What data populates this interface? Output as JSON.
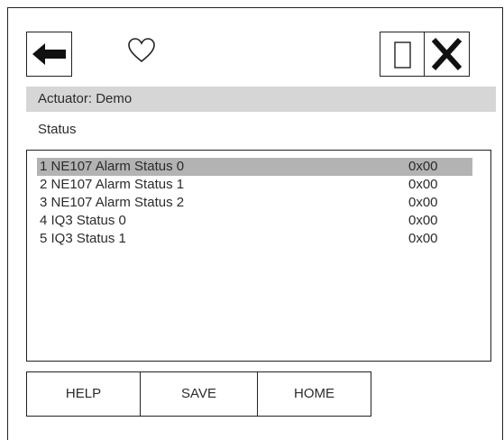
{
  "header": {
    "back_icon": "left-arrow-icon",
    "favorite_icon": "heart-outline-icon",
    "window_icon": "window-rectangle-icon",
    "close_icon": "close-x-icon"
  },
  "actuator_label": "Actuator: Demo",
  "section_title": "Status",
  "rows": [
    {
      "name": "1 NE107 Alarm Status 0",
      "value": "0x00",
      "selected": true
    },
    {
      "name": "2 NE107 Alarm Status 1",
      "value": "0x00",
      "selected": false
    },
    {
      "name": "3 NE107 Alarm Status 2",
      "value": "0x00",
      "selected": false
    },
    {
      "name": "4 IQ3 Status 0",
      "value": "0x00",
      "selected": false
    },
    {
      "name": "5 IQ3 Status 1",
      "value": "0x00",
      "selected": false
    }
  ],
  "buttons": {
    "help": "HELP",
    "save": "SAVE",
    "home": "HOME"
  },
  "colors": {
    "bar_bg": "#d6d6d6",
    "selected_bg": "#b3b3b3",
    "border": "#222222"
  }
}
